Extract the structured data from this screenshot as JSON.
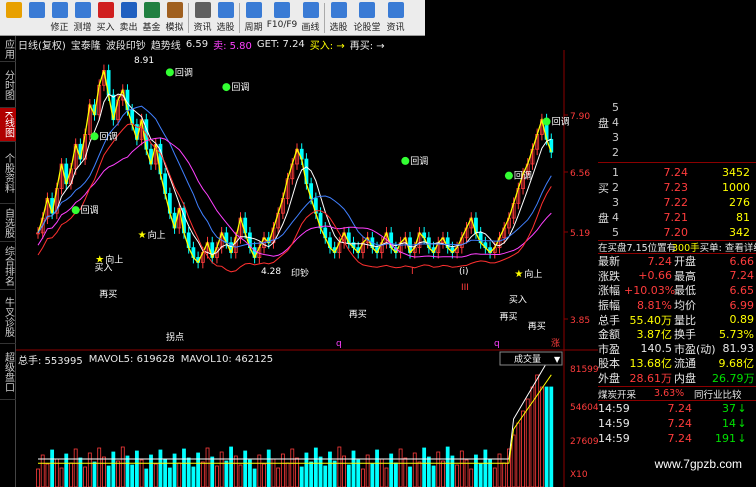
{
  "toolbar": {
    "buttons": [
      {
        "label": "",
        "icon": "star-icon",
        "color": "#e8a000"
      },
      {
        "label": "",
        "icon": "search-icon",
        "color": "#3a7bd5"
      },
      {
        "label": "修正",
        "icon": "edit-icon",
        "color": "#3a7bd5"
      },
      {
        "label": "测增",
        "icon": "add-icon",
        "color": "#3a7bd5"
      },
      {
        "label": "买入",
        "icon": "buy-icon",
        "color": "#d02020"
      },
      {
        "label": "卖出",
        "icon": "sell-icon",
        "color": "#2060c0"
      },
      {
        "label": "基金",
        "icon": "fund-icon",
        "color": "#208040"
      },
      {
        "label": "模拟",
        "icon": "hammer-icon",
        "color": "#a06020"
      },
      {
        "label": "资讯",
        "icon": "news-icon",
        "color": "#606060"
      },
      {
        "label": "选股",
        "icon": "select-icon",
        "color": "#3a7bd5"
      },
      {
        "label": "周期",
        "icon": "period-icon",
        "color": "#3a7bd5"
      },
      {
        "label": "F10/F9",
        "icon": "f10-icon",
        "color": "#3a7bd5"
      },
      {
        "label": "画线",
        "icon": "pencil-icon",
        "color": "#3a7bd5"
      },
      {
        "label": "选股",
        "icon": "filter-icon",
        "color": "#3a7bd5"
      },
      {
        "label": "论股堂",
        "icon": "forum-icon",
        "color": "#3a7bd5"
      },
      {
        "label": "资讯",
        "icon": "info-icon",
        "color": "#3a7bd5"
      }
    ]
  },
  "sidebar": {
    "tabs": [
      {
        "label": "应用",
        "active": false
      },
      {
        "label": "分时图",
        "active": false
      },
      {
        "label": "K线图",
        "active": true
      },
      {
        "label": "个股资料",
        "active": false
      },
      {
        "label": "自选股",
        "active": false
      },
      {
        "label": "综合排名",
        "active": false
      },
      {
        "label": "牛叉诊股",
        "active": false
      },
      {
        "label": "超级盘口",
        "active": false
      }
    ]
  },
  "main_header": {
    "period": "日线(复权)",
    "stock": "宝泰隆",
    "indicator": "波段印钞",
    "trend": "趋势线",
    "trend_val": "6.59",
    "sell_label": "卖: 5.80",
    "get_label": "GET: 7.24",
    "buy_label": "买入: →",
    "buy2_label": "再买: →"
  },
  "price_axis": [
    "7.90",
    "6.56",
    "5.19",
    "3.85"
  ],
  "chart_labels": {
    "top_value": "8.91",
    "huitiao": "回调",
    "xiangshang": "向上",
    "mairu": "买入",
    "zaimai": "再买",
    "yinchao": "印钞",
    "guaidian": "拐点",
    "low_value": "4.28",
    "roman_q": "q",
    "zhang": "涨",
    "roman_iii": "III",
    "roman_i": "I",
    "paren_i": "(i)"
  },
  "volume_header": {
    "total": "总手: 553995",
    "mavol5": "MAVOL5: 619628",
    "mavol10": "MAVOL10: 462125",
    "dropdown": "成交量"
  },
  "volume_axis": [
    "81599",
    "54604",
    "27609",
    "X10"
  ],
  "order_book": {
    "sell": [
      {
        "side": "",
        "idx": "5",
        "price": "",
        "vol": ""
      },
      {
        "side": "盘",
        "idx": "4",
        "price": "",
        "vol": ""
      },
      {
        "side": "",
        "idx": "3",
        "price": "",
        "vol": ""
      },
      {
        "side": "",
        "idx": "2",
        "price": "",
        "vol": ""
      }
    ],
    "buy": [
      {
        "side": "",
        "idx": "1",
        "price": "7.24",
        "vol": "3452"
      },
      {
        "side": "买",
        "idx": "2",
        "price": "7.23",
        "vol": "1000"
      },
      {
        "side": "",
        "idx": "3",
        "price": "7.22",
        "vol": "276"
      },
      {
        "side": "盘",
        "idx": "4",
        "price": "7.21",
        "vol": "81"
      },
      {
        "side": "",
        "idx": "5",
        "price": "7.20",
        "vol": "342"
      }
    ]
  },
  "quote_bar": {
    "left": "在买盘7.15位置有",
    "mid": "300手",
    "right": "买单: 查看详细"
  },
  "stats": [
    {
      "l1": "最新",
      "v1": "7.24",
      "c1": "red",
      "l2": "开盘",
      "v2": "6.66",
      "c2": "red"
    },
    {
      "l1": "涨跌",
      "v1": "+0.66",
      "c1": "red",
      "l2": "最高",
      "v2": "7.24",
      "c2": "red"
    },
    {
      "l1": "涨幅",
      "v1": "+10.03%",
      "c1": "red",
      "l2": "最低",
      "v2": "6.65",
      "c2": "red"
    },
    {
      "l1": "振幅",
      "v1": "8.81%",
      "c1": "red",
      "l2": "均价",
      "v2": "6.99",
      "c2": "red"
    },
    {
      "l1": "总手",
      "v1": "55.40万",
      "c1": "yellow",
      "l2": "量比",
      "v2": "0.89",
      "c2": "yellow"
    },
    {
      "l1": "金额",
      "v1": "3.87亿",
      "c1": "yellow",
      "l2": "换手",
      "v2": "5.73%",
      "c2": "yellow"
    },
    {
      "l1": "市盈",
      "v1": "140.5",
      "c1": "white",
      "l2": "市盈(动)",
      "v2": "81.93",
      "c2": "white"
    },
    {
      "l1": "股本",
      "v1": "13.68亿",
      "c1": "yellow",
      "l2": "流通",
      "v2": "9.68亿",
      "c2": "yellow"
    },
    {
      "l1": "外盘",
      "v1": "28.61万",
      "c1": "red",
      "l2": "内盘",
      "v2": "26.79万",
      "c2": "green"
    }
  ],
  "tabs_bottom": {
    "left": "煤炭开采",
    "pct": "3.63%",
    "right": "同行业比较"
  },
  "ticks": [
    {
      "time": "14:59",
      "price": "7.24",
      "vol": "37",
      "dir": "down"
    },
    {
      "time": "14:59",
      "price": "7.24",
      "vol": "14",
      "dir": "down"
    },
    {
      "time": "14:59",
      "price": "7.24",
      "vol": "191",
      "dir": "down"
    }
  ],
  "watermark": "www.7gpzb.com",
  "colors": {
    "up": "#ff3c3c",
    "down": "#00ffff",
    "ma_white": "#ffffff",
    "ma_yellow": "#ffff00",
    "ma_magenta": "#ff40ff",
    "ma_blue": "#4080ff",
    "signal_green": "#33ff33"
  }
}
